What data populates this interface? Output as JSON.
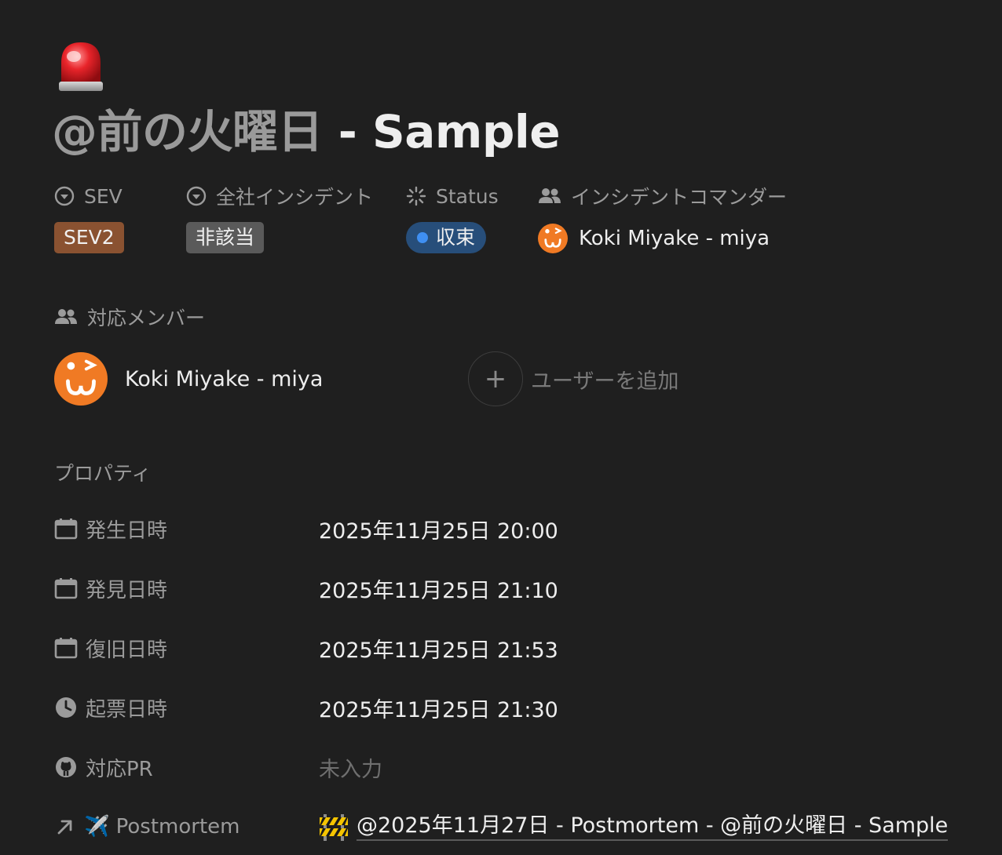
{
  "page": {
    "icon": "police-light-icon",
    "title_mention": "@前の火曜日",
    "title_rest": " - Sample"
  },
  "header_props": [
    {
      "icon": "select-icon",
      "label": "SEV"
    },
    {
      "icon": "select-icon",
      "label": "全社インシデント"
    },
    {
      "icon": "status-icon",
      "label": "Status"
    },
    {
      "icon": "people-icon",
      "label": "インシデントコマンダー"
    }
  ],
  "sev_tag": "SEV2",
  "company_wide_tag": "非該当",
  "status_tag": "収束",
  "commander_name": "Koki Miyake - miya",
  "members": {
    "label": "対応メンバー",
    "items": [
      {
        "name": "Koki Miyake - miya"
      }
    ],
    "add_user_label": "ユーザーを追加"
  },
  "properties": {
    "section_label": "プロパティ",
    "rows": [
      {
        "icon": "calendar-icon",
        "label": "発生日時",
        "value": "2025年11月25日 20:00"
      },
      {
        "icon": "calendar-icon",
        "label": "発見日時",
        "value": "2025年11月25日 21:10"
      },
      {
        "icon": "calendar-icon",
        "label": "復旧日時",
        "value": "2025年11月25日 21:53"
      },
      {
        "icon": "clock-icon",
        "label": "起票日時",
        "value": "2025年11月25日 21:30"
      },
      {
        "icon": "github-icon",
        "label": "対応PR",
        "value": "未入力"
      },
      {
        "icon": "relation-arrow-icon",
        "label": "✈️ Postmortem",
        "value": "@2025年11月27日 - Postmortem - @前の火曜日 - Sample"
      }
    ]
  },
  "colors": {
    "background": "#1f1f1f",
    "sev_tag": "#8a5231",
    "neutral_tag": "#5a5a5a",
    "status_tag": "#274e7a",
    "status_dot": "#3f8ff2",
    "avatar": "#f07a24"
  }
}
